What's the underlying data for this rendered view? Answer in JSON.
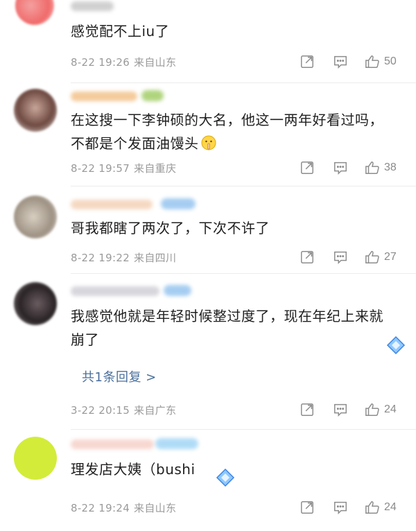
{
  "comments": [
    {
      "text": "感觉配不上iu了",
      "date": "8-22 19:26",
      "location": "来自山东",
      "likes": "50",
      "avatar_color": "#f08a8a"
    },
    {
      "text": "在这搜一下李钟硕的大名，他这一两年好看过吗，不都是个发面油馒头",
      "date": "8-22 19:57",
      "location": "来自重庆",
      "likes": "38",
      "avatar_color": "#7a5a50"
    },
    {
      "text": "哥我都瞎了两次了，下次不许了",
      "date": "8-22 19:22",
      "location": "来自四川",
      "likes": "27",
      "avatar_color": "#b8a898"
    },
    {
      "text": "我感觉他就是年轻时候整过度了，现在年纪上来就崩了",
      "date": "3-22 20:15",
      "location": "来自广东",
      "likes": "24",
      "avatar_color": "#3c3638",
      "replies_label": "共1条回复 >"
    },
    {
      "text": "理发店大姨（bushi",
      "date": "8-22 19:24",
      "location": "来自山东",
      "likes": "24",
      "avatar_color": "#d6ee38"
    }
  ],
  "icons": {
    "share": "share-icon",
    "reply": "comment-icon",
    "like": "thumbs-up-icon",
    "emoji": "shush-emoji-icon",
    "badge": "diamond-badge-icon"
  },
  "colors": {
    "link": "#4a6f9c",
    "meta": "#9a9a9a",
    "accent_blue": "#6fb2f5"
  }
}
